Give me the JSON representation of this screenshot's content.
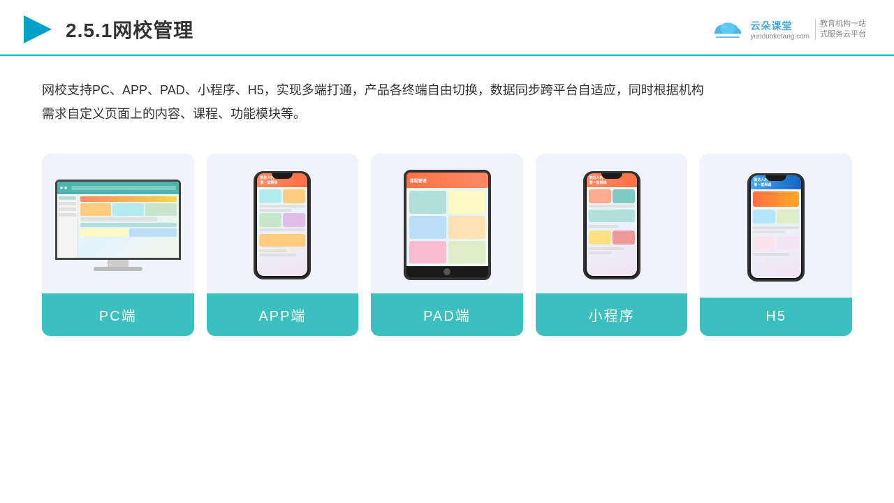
{
  "header": {
    "title": "2.5.1网校管理",
    "logo": {
      "name": "云朵课堂",
      "url": "yunduoketang.com",
      "slogan": "教育机构一站\n式服务云平台"
    }
  },
  "description": "网校支持PC、APP、PAD、小程序、H5，实现多端打通，产品各终端自由切换，数据同步跨平台自适应，同时根据机构\n需求自定义页面上的内容、课程、功能模块等。",
  "cards": [
    {
      "id": "pc",
      "label": "PC端"
    },
    {
      "id": "app",
      "label": "APP端"
    },
    {
      "id": "pad",
      "label": "PAD端"
    },
    {
      "id": "miniapp",
      "label": "小程序"
    },
    {
      "id": "h5",
      "label": "H5"
    }
  ],
  "accent_color": "#3bbfbf",
  "bg_color": "#f0f4fa"
}
